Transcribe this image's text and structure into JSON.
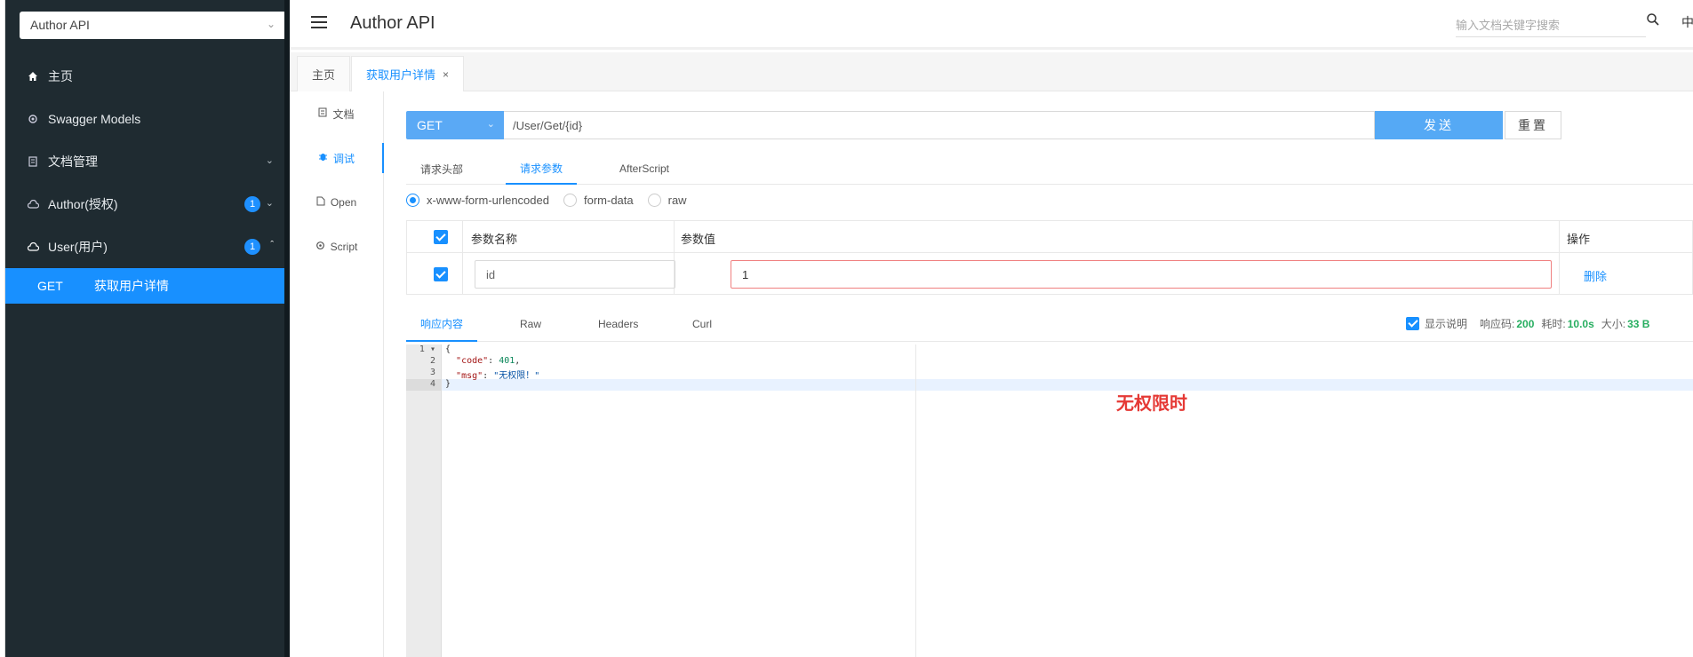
{
  "sidebar": {
    "api_select": "Author API",
    "items": [
      {
        "label": "主页",
        "icon": "home-icon"
      },
      {
        "label": "Swagger Models",
        "icon": "gear-icon"
      },
      {
        "label": "文档管理",
        "icon": "document-icon"
      },
      {
        "label": "Author(授权)",
        "icon": "cloud-icon",
        "badge": "1"
      },
      {
        "label": "User(用户)",
        "icon": "cloud-icon",
        "badge": "1"
      }
    ],
    "sub_item": {
      "method": "GET",
      "label": "获取用户详情"
    }
  },
  "header": {
    "title": "Author API",
    "search_placeholder": "输入文档关键字搜索",
    "lang": "中"
  },
  "page_tabs": [
    {
      "label": "主页"
    },
    {
      "label": "获取用户详情",
      "close": "×"
    }
  ],
  "vtabs": [
    {
      "label": "文档"
    },
    {
      "label": "调试"
    },
    {
      "label": "Open"
    },
    {
      "label": "Script"
    }
  ],
  "request": {
    "method": "GET",
    "url": "/User/Get/{id}",
    "send_label": "发送",
    "reset_label": "重置"
  },
  "request_tabs": [
    "请求头部",
    "请求参数",
    "AfterScript"
  ],
  "content_types": [
    "x-www-form-urlencoded",
    "form-data",
    "raw"
  ],
  "params_table": {
    "headers": [
      "参数名称",
      "参数值",
      "操作"
    ],
    "rows": [
      {
        "name": "id",
        "value": "1",
        "action": "删除"
      }
    ]
  },
  "response_tabs": [
    "响应内容",
    "Raw",
    "Headers",
    "Curl"
  ],
  "response_meta": {
    "show_desc": "显示说明",
    "code_label": "响应码:",
    "code": "200",
    "time_label": "耗时:",
    "time": "10.0s",
    "size_label": "大小:",
    "size": "33 B"
  },
  "editor": {
    "lines": [
      "1",
      "2",
      "3",
      "4"
    ],
    "code_key": "\"code\"",
    "code_value": "401",
    "msg_key": "\"msg\"",
    "msg_value": "\"无权限！\""
  },
  "annotation": "无权限时",
  "colors": {
    "accent": "#1890ff",
    "sidebar_bg": "#1f2b31",
    "annotation": "#e53935"
  }
}
